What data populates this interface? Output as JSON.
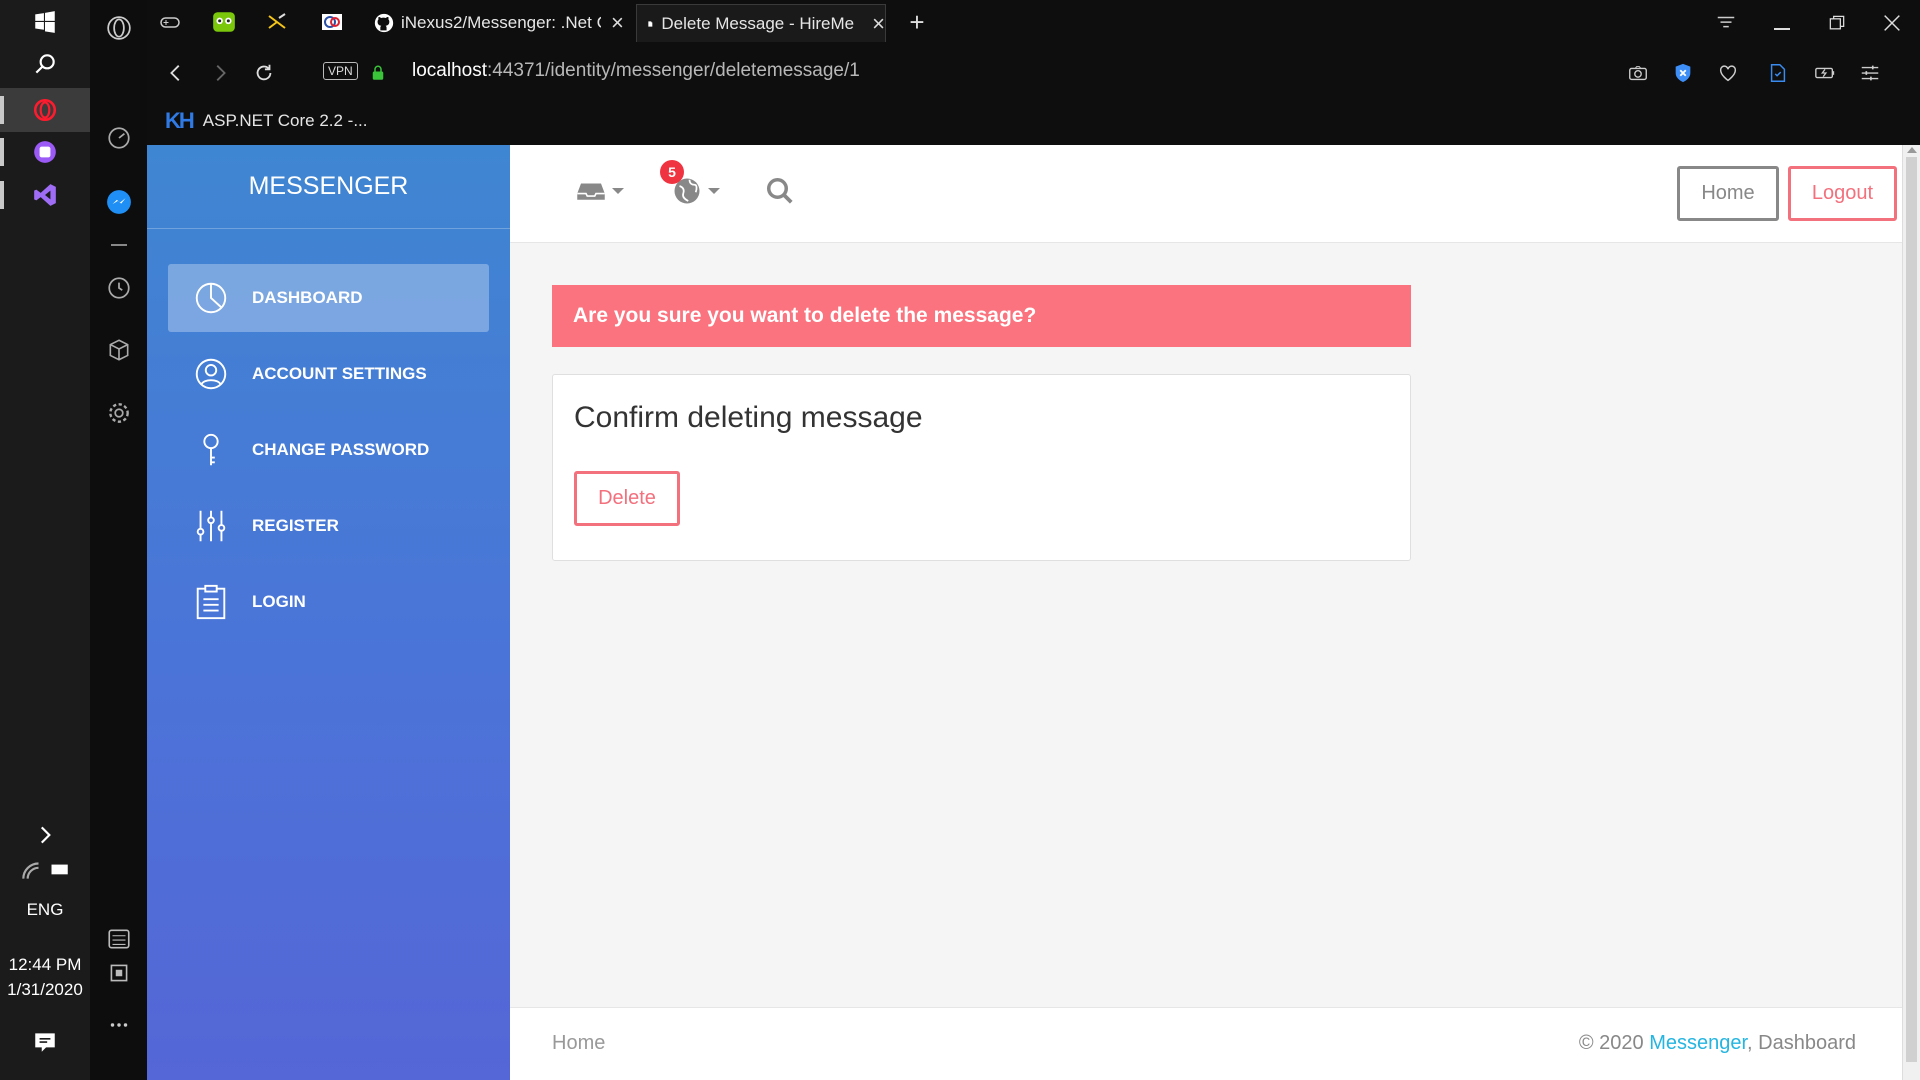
{
  "taskbar": {
    "language": "ENG",
    "time": "12:44 PM",
    "date": "1/31/2020"
  },
  "browser": {
    "tabs": [
      {
        "title": "iNexus2/Messenger: .Net C",
        "icon": "github-icon"
      },
      {
        "title": "Delete Message - HireMe",
        "icon": "document-icon",
        "active": true
      }
    ],
    "vpn_label": "VPN",
    "url_host": "localhost",
    "url_rest": ":44371/identity/messenger/deletemessage/1",
    "bookmark": {
      "logo": "KH",
      "label": "ASP.NET Core 2.2 -..."
    }
  },
  "sidebar": {
    "brand": "MESSENGER",
    "items": [
      {
        "label": "DASHBOARD",
        "icon": "pie-chart-icon",
        "active": true
      },
      {
        "label": "ACCOUNT SETTINGS",
        "icon": "user-icon"
      },
      {
        "label": "CHANGE PASSWORD",
        "icon": "key-icon"
      },
      {
        "label": "REGISTER",
        "icon": "sliders-icon"
      },
      {
        "label": "LOGIN",
        "icon": "clipboard-icon"
      }
    ]
  },
  "topnav": {
    "notification_count": "5",
    "home_label": "Home",
    "logout_label": "Logout"
  },
  "main": {
    "alert": "Are you sure you want to delete the message?",
    "card_title": "Confirm deleting message",
    "delete_label": "Delete"
  },
  "footer": {
    "home_link": "Home",
    "copyright_prefix": "© 2020 ",
    "brand_link": "Messenger",
    "suffix": ", Dashboard"
  },
  "colors": {
    "accent_red": "#fb737e",
    "sidebar_top": "#3f86d2",
    "sidebar_bottom": "#5566d6",
    "link_blue": "#25b5e0"
  }
}
